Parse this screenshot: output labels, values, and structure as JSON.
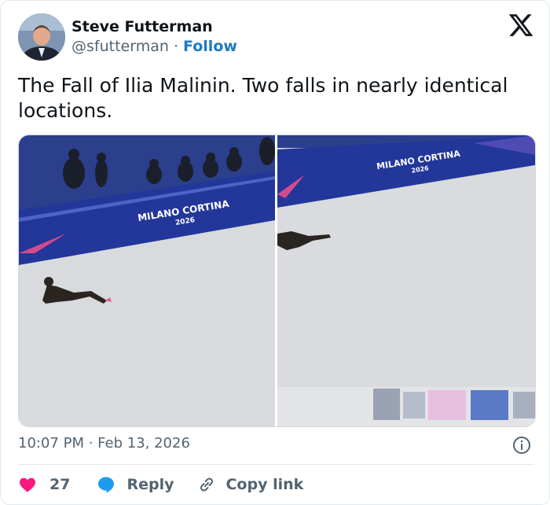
{
  "author": {
    "name": "Steve Futterman",
    "handle": "@sfutterman",
    "separator": "·",
    "follow_label": "Follow"
  },
  "tweet": {
    "text": "The Fall of Ilia Malinin. Two falls in nearly identical locations.",
    "timestamp": "10:07 PM · Feb 13, 2026"
  },
  "media": {
    "left_board_text": "MILANO CORTINA",
    "left_board_year": "2026",
    "right_board_text": "MILANO CORTINA",
    "right_board_year": "2026"
  },
  "actions": {
    "like_count": "27",
    "reply_label": "Reply",
    "copy_label": "Copy link"
  },
  "colors": {
    "like": "#f91880",
    "reply": "#1d9bf0",
    "follow": "#1d79c4",
    "board_blue": "#23369a"
  },
  "icons": [
    "x-logo-icon",
    "heart-icon",
    "reply-bubble-icon",
    "link-icon",
    "info-icon"
  ]
}
